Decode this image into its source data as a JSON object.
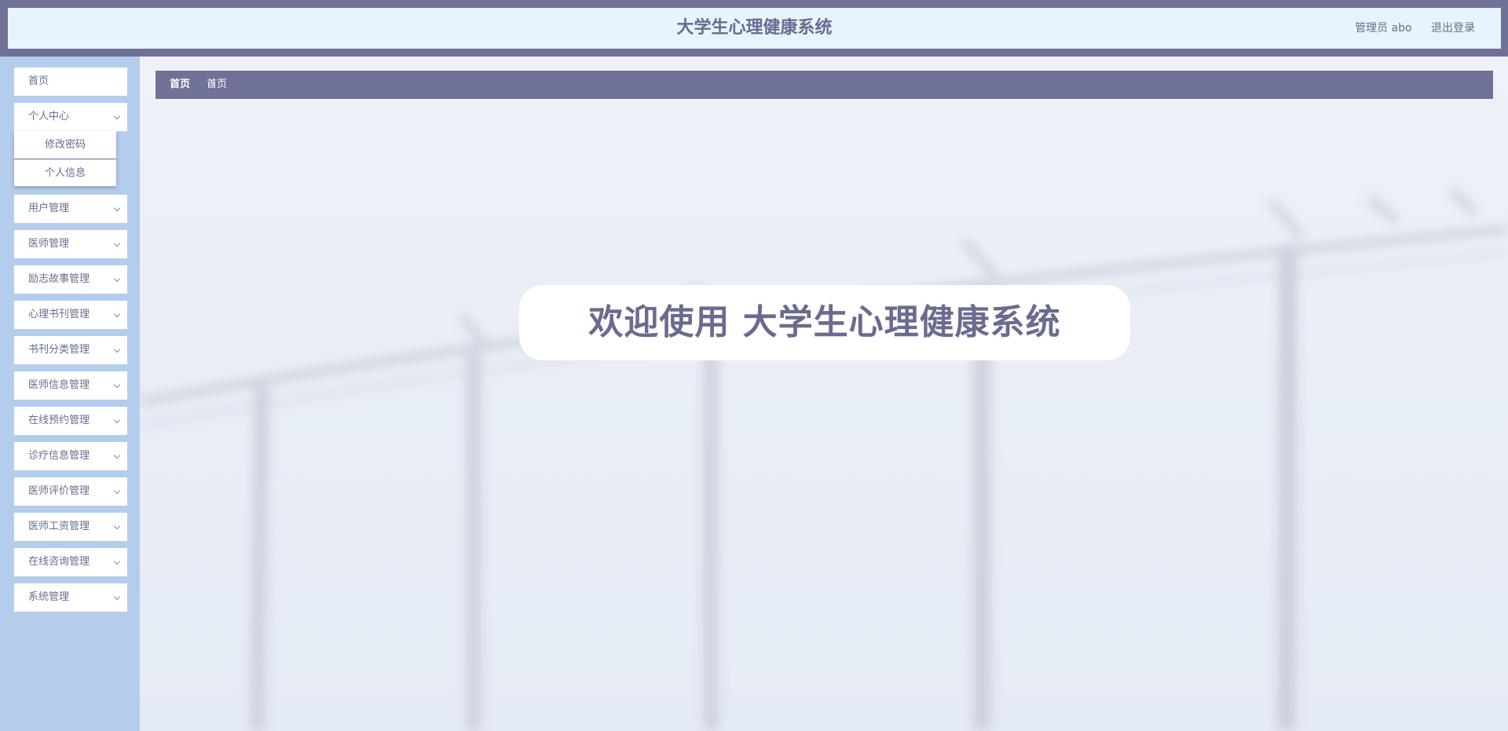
{
  "header": {
    "title": "大学生心理健康系统",
    "user_label": "管理员 abo",
    "logout_label": "退出登录"
  },
  "sidebar": {
    "items": [
      {
        "label": "首页",
        "has_children": false
      },
      {
        "label": "个人中心",
        "has_children": true,
        "expanded": true
      },
      {
        "label": "用户管理",
        "has_children": true
      },
      {
        "label": "医师管理",
        "has_children": true
      },
      {
        "label": "励志故事管理",
        "has_children": true
      },
      {
        "label": "心理书刊管理",
        "has_children": true
      },
      {
        "label": "书刊分类管理",
        "has_children": true
      },
      {
        "label": "医师信息管理",
        "has_children": true
      },
      {
        "label": "在线预约管理",
        "has_children": true
      },
      {
        "label": "诊疗信息管理",
        "has_children": true
      },
      {
        "label": "医师评价管理",
        "has_children": true
      },
      {
        "label": "医师工资管理",
        "has_children": true
      },
      {
        "label": "在线咨询管理",
        "has_children": true
      },
      {
        "label": "系统管理",
        "has_children": true
      }
    ],
    "submenu": [
      {
        "label": "修改密码"
      },
      {
        "label": "个人信息"
      }
    ]
  },
  "breadcrumb": {
    "home": "首页",
    "separator": "/",
    "current": "首页"
  },
  "main": {
    "welcome_text": "欢迎使用 大学生心理健康系统"
  },
  "colors": {
    "accent": "#707196",
    "header_bg": "#e6f5fd",
    "sidebar_bg": "#b5cdec",
    "text": "#6a6b8e"
  }
}
